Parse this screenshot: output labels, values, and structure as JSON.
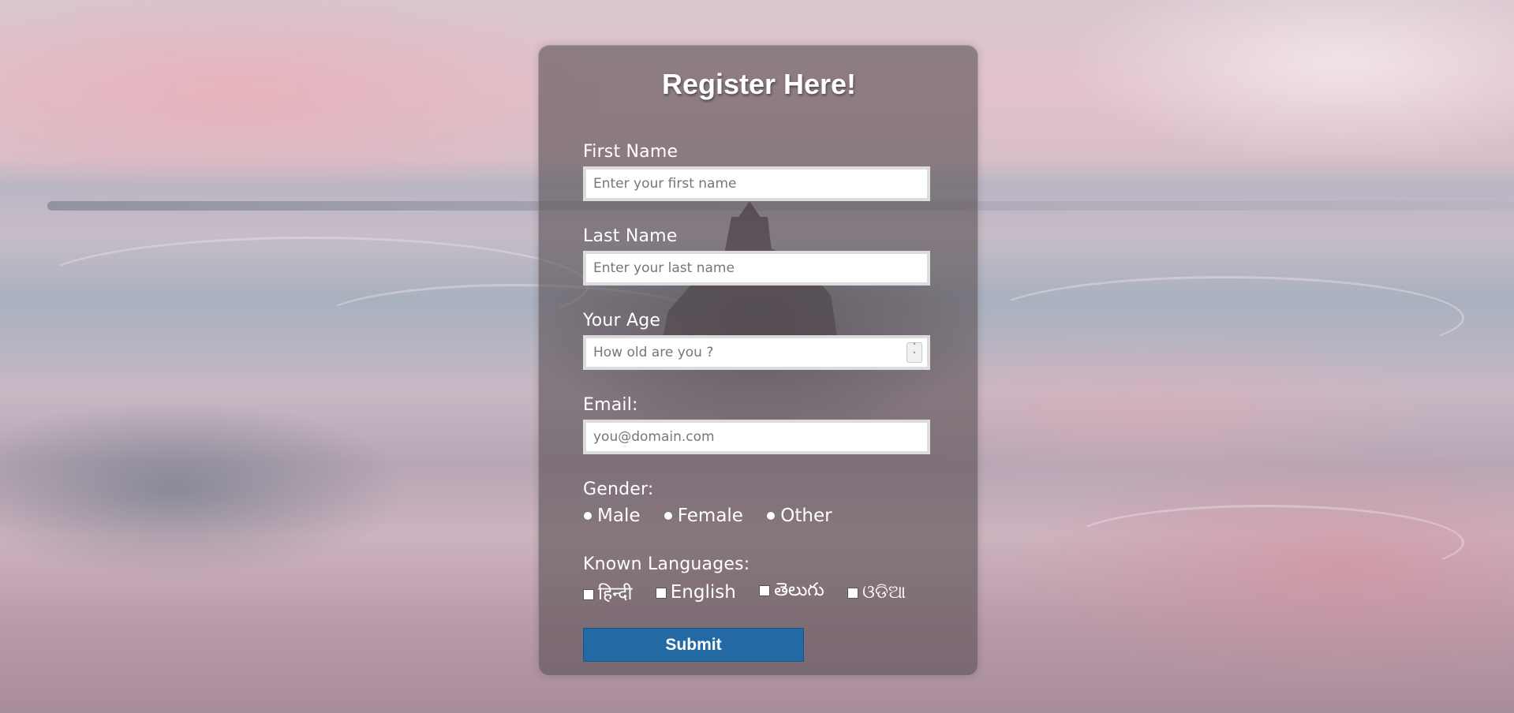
{
  "form": {
    "title": "Register Here!",
    "first_name": {
      "label": "First Name",
      "placeholder": "Enter your first name",
      "value": ""
    },
    "last_name": {
      "label": "Last Name",
      "placeholder": "Enter your last name",
      "value": ""
    },
    "age": {
      "label": "Your Age",
      "placeholder": "How old are you ?",
      "value": ""
    },
    "email": {
      "label": "Email:",
      "placeholder": "you@domain.com",
      "value": ""
    },
    "gender": {
      "label": "Gender:",
      "options": [
        {
          "label": "Male",
          "selected": false
        },
        {
          "label": "Female",
          "selected": false
        },
        {
          "label": "Other",
          "selected": false
        }
      ]
    },
    "languages": {
      "label": "Known Languages:",
      "options": [
        {
          "label": "हिन्दी",
          "checked": false
        },
        {
          "label": "English",
          "checked": false
        },
        {
          "label": "తెలుగు",
          "checked": false
        },
        {
          "label": "ଓଡିଆ",
          "checked": false
        }
      ]
    },
    "submit_label": "Submit"
  },
  "colors": {
    "submit_button": "#236aa5",
    "card_background": "#5a5055",
    "text": "#ffffff"
  },
  "icons": {
    "age_spinner": "spinner-arrows-icon"
  }
}
